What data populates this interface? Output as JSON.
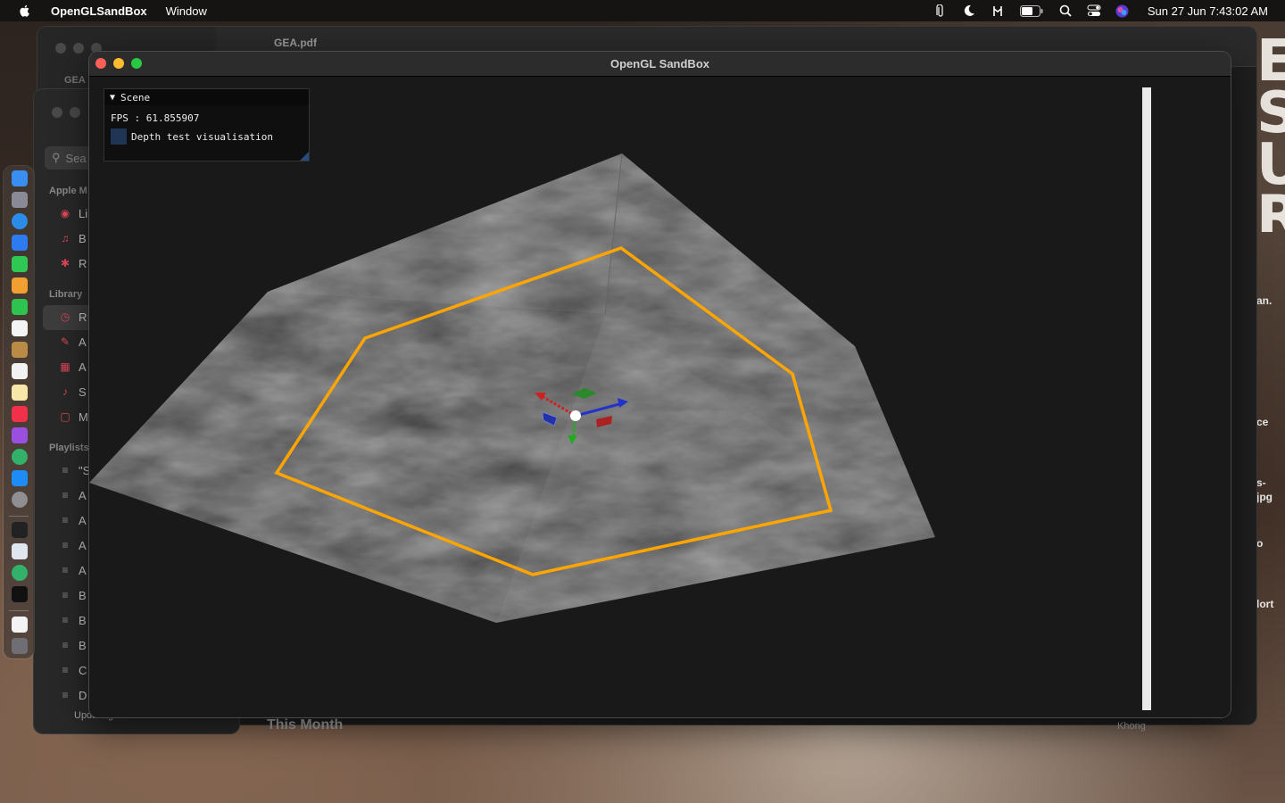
{
  "menubar": {
    "app_name": "OpenGLSandBox",
    "menus": [
      "Window"
    ],
    "clock": "Sun 27 Jun  7:43:02 AM",
    "status_icons": [
      "paperclip-icon",
      "moon-icon",
      "antenna-icon",
      "battery-icon",
      "search-icon",
      "control-center-icon",
      "siri-icon"
    ]
  },
  "back_window": {
    "title": "GEA.pdf",
    "sidebar_label": "GEA",
    "bottom_label": "This Month",
    "right_label": "Khong"
  },
  "music_window": {
    "search_placeholder": "Sea",
    "sections": {
      "apple": "Apple M",
      "library": "Library",
      "playlists": "Playlists"
    },
    "apple_rows": [
      "Li",
      "B",
      "R"
    ],
    "library_rows": [
      "R",
      "A",
      "A",
      "S",
      "M"
    ],
    "playlist_rows": [
      "\"S",
      "A",
      "A",
      "A",
      "A",
      "B",
      "B",
      "B",
      "C",
      "D"
    ],
    "status": "Updating artist artwork..."
  },
  "poster_snippets": [
    "an.",
    "ce",
    "s-",
    "jpg",
    "o",
    "lort"
  ],
  "gl_window": {
    "title": "OpenGL SandBox",
    "panel": {
      "header": "Scene",
      "fps_text": "FPS : 61.855907",
      "checkbox_label": "Depth test visualisation",
      "checkbox_checked": false
    }
  },
  "colors": {
    "outline": "#ffa500",
    "axis_x": "#cc2222",
    "axis_y": "#22aa22",
    "axis_z": "#2233cc",
    "traffic_close": "#fe5f57",
    "traffic_min": "#febc2e",
    "traffic_max": "#28c840"
  }
}
